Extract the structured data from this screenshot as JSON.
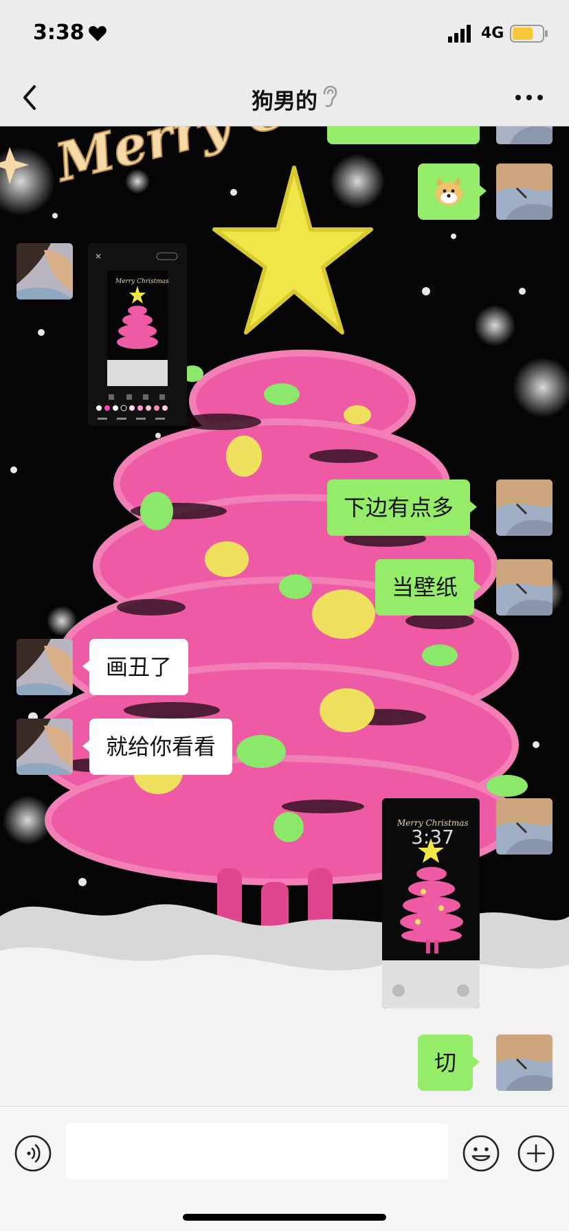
{
  "status_bar": {
    "time": "3:38",
    "network": "4G",
    "battery_level": 0.7,
    "battery_color": "#f6c63b"
  },
  "nav": {
    "title": "狗男的",
    "back_icon": "chevron-left-icon",
    "more_icon": "more-dots-icon",
    "earpiece_icon": "ear-icon"
  },
  "background": {
    "greeting": "Merry Christmas"
  },
  "messages": [
    {
      "side": "right",
      "type": "text",
      "text": ""
    },
    {
      "side": "right",
      "type": "sticker",
      "sticker": "doge-emoji"
    },
    {
      "side": "left",
      "type": "image",
      "description": ""
    },
    {
      "side": "right",
      "type": "text",
      "text": "下边有点多"
    },
    {
      "side": "right",
      "type": "text",
      "text": "当壁纸"
    },
    {
      "side": "left",
      "type": "text",
      "text": "画丑了"
    },
    {
      "side": "left",
      "type": "text",
      "text": "就给你看看"
    },
    {
      "side": "right",
      "type": "image",
      "description": ""
    },
    {
      "side": "right",
      "type": "text",
      "text": "切"
    }
  ],
  "thumbnails": {
    "editor_greeting": "Merry Christmas",
    "lock_greeting": "Merry Christmas",
    "lock_time": "3:37"
  },
  "input_bar": {
    "placeholder": "",
    "voice_icon": "voice-icon",
    "emoji_icon": "emoji-icon",
    "plus_icon": "plus-icon"
  },
  "colors": {
    "bubble_right": "#95ec69",
    "bubble_left": "#ffffff",
    "tree_pink": "#ee5aa3",
    "star_yellow": "#f2e547"
  }
}
